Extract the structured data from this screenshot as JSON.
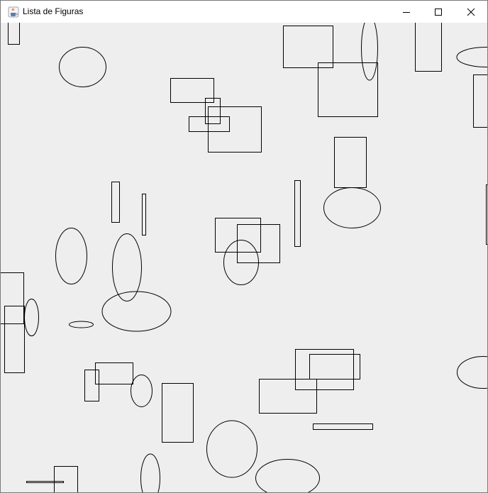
{
  "window": {
    "title": "Lista de Figuras",
    "icon": "java-coffee-cup-icon"
  },
  "title_controls": {
    "minimize_icon": "minimize-icon",
    "maximize_icon": "maximize-icon",
    "close_icon": "close-icon"
  },
  "colors": {
    "canvas_background": "#eeeeee",
    "titlebar_background": "#ffffff",
    "shape_stroke": "#000000"
  }
}
